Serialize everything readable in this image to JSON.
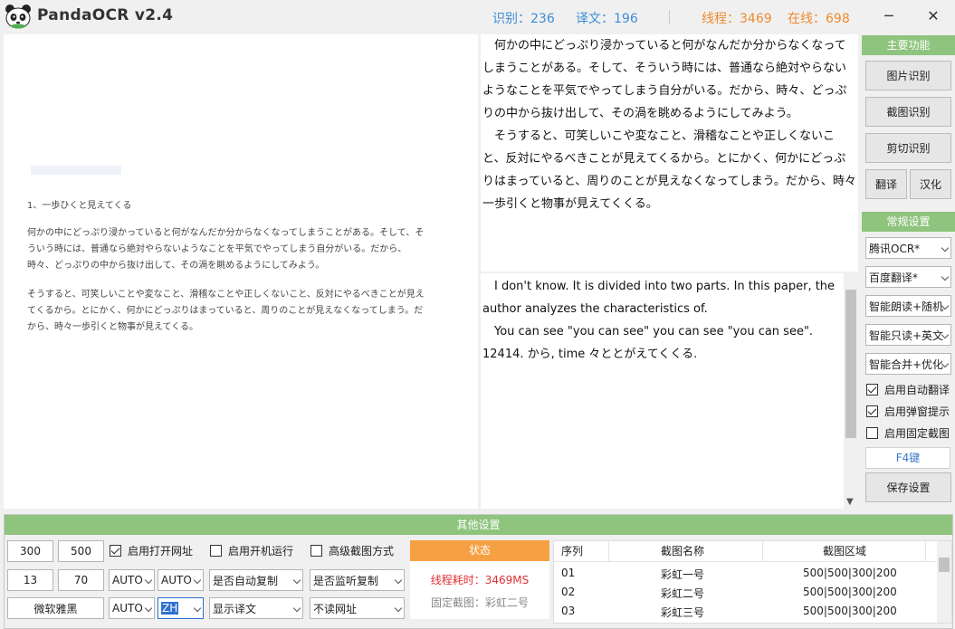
{
  "app": {
    "title": "PandaOCR v2.4"
  },
  "stats": {
    "recognize": "识别：236",
    "translate": "译文：196",
    "threads": "线程：3469",
    "online": "在线：698"
  },
  "window": {
    "minimize": "─",
    "close": "✕"
  },
  "source_image": {
    "heading": "1、一歩ひくと見えてくる",
    "paragraph1": [
      "何かの中にどっぷり浸かっていると何がなんだか分からなくなってしまうことがある。そして、そ",
      "ういう時には、普通なら絶対やらないようなことを平気でやってしまう自分がいる。だから、",
      "時々、どっぷりの中から抜け出して、その渦を眺めるようにしてみよう。"
    ],
    "paragraph2": [
      "そうすると、可笑しいことや変なこと、滑稽なことや正しくないこと、反対にやるべきことが見え",
      "てくるから。とにかく、何かにどっぷりはまっていると、周りのことが見えなくなってしまう。だ",
      "から、時々一歩引くと物事が見えてくる。"
    ]
  },
  "ocr_text": {
    "paragraph1": "　何かの中にどっぷり浸かっていると何がなんだか分からなくなってしまうことがある。そして、そういう時には、普通なら絶対やらないようなことを平気でやってしまう自分がいる。だから、時々、どっぷりの中から抜け出して、その渦を眺めるようにしてみよう。",
    "paragraph2": "　そうすると、可笑しいこや変なこと、滑稽なことや正しくないこと、反対にやるべきことが見えてくるから。とにかく、何かにどっぷりはまっていると、周りのことが見えなくなってしまう。だから、時々一歩引くと物事が見えてくくる。"
  },
  "translation_text": {
    "paragraph1": "　I don't know. It is divided into two parts. In this paper, the author analyzes the characteristics of.",
    "paragraph2": "　You can see \"you can see\" you can see \"you can see\". 12414. から, time 々ととがえてくくる."
  },
  "main_functions": {
    "header": "主要功能",
    "image_ocr": "图片识别",
    "screenshot_ocr": "截图识别",
    "clipboard_ocr": "剪切识别",
    "translate": "翻译",
    "chinese": "汉化"
  },
  "general_settings": {
    "header": "常规设置",
    "ocr_engine": "腾讯OCR*",
    "translate_engine": "百度翻译*",
    "read_mode": "智能朗读+随机",
    "read_only": "智能只读+英文",
    "merge_mode": "智能合并+优化",
    "auto_translate": "启用自动翻译",
    "popup_hint": "启用弹窗提示",
    "fixed_capture": "启用固定截图",
    "hotkey": "F4键",
    "save": "保存设置"
  },
  "other_settings": {
    "header": "其他设置",
    "width": "300",
    "height": "500",
    "val1": "13",
    "val2": "70",
    "font": "微软雅黑",
    "open_url": "启用打开网址",
    "autostart": "启用开机运行",
    "advanced_capture": "高级截图方式",
    "lang1": "AUTO",
    "lang2": "AUTO",
    "lang3": "AUTO",
    "lang4": "ZH",
    "auto_copy": "是否自动复制",
    "listen_copy": "是否监听复制",
    "show_translation": "显示译文",
    "no_read_url": "不读网址"
  },
  "status_box": {
    "header": "状态",
    "elapsed": "线程耗时：3469MS",
    "fixed": "固定截图：彩虹二号"
  },
  "capture_table": {
    "headers": [
      "序列",
      "截图名称",
      "截图区域"
    ],
    "rows": [
      [
        "01",
        "彩虹一号",
        "500|500|300|200"
      ],
      [
        "02",
        "彩虹二号",
        "500|500|300|200"
      ],
      [
        "03",
        "彩虹三号",
        "500|500|300|200"
      ]
    ]
  },
  "colors": {
    "accent_green": "#8ec47d",
    "stat_blue": "#3c8cd8",
    "stat_orange": "#f08a2c",
    "status_orange": "#f5a043",
    "status_red": "#e03030"
  }
}
